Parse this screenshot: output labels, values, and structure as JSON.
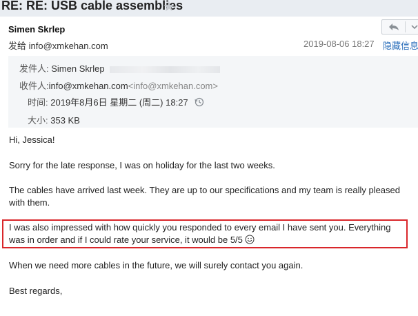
{
  "header": {
    "title": "RE: RE: USB cable assemblies",
    "star_icon": "star-icon"
  },
  "message": {
    "sender_name": "Simen Skrlep",
    "sent_to": "发给 info@xmkehan.com",
    "date": "2019-08-06 18:27",
    "hide_info_label": "隐藏信息",
    "nav": {
      "reply_icon": "reply-icon",
      "dropdown_icon": "chevron-down-icon"
    },
    "details": {
      "from_label": "发件人:",
      "from_value": "Simen Skrlep",
      "to_label": "收件人:",
      "to_value": "info@xmkehan.com",
      "to_angle": "<info@xmkehan.com>",
      "time_label": "时间:",
      "time_value": "2019年8月6日 星期二 (周二) 18:27",
      "size_label": "大小:",
      "size_value": "353 KB"
    }
  },
  "body": {
    "greeting": "Hi, Jessica!",
    "p1": "Sorry for the late response, I was on holiday for the last two weeks.",
    "p2": "The cables have arrived last week. They are up to our specifications and my team is really pleased with them.",
    "p3": "I was also impressed with how quickly you responded to every email I have sent you. Everything was in order and if I could rate your service, it would be 5/5",
    "p4": "When we need more cables in the future, we will surely contact you again.",
    "closing": "Best regards,"
  },
  "colors": {
    "highlight_border": "#d9262a",
    "link": "#2a6ebb"
  }
}
